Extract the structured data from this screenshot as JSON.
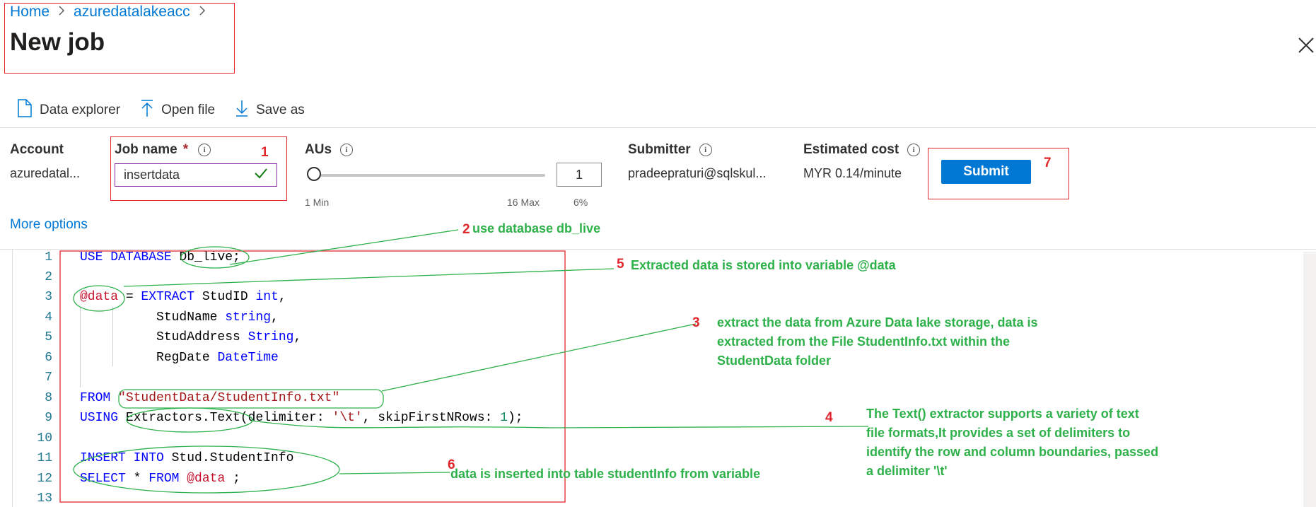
{
  "breadcrumb": {
    "home": "Home",
    "account": "azuredatalakeacc",
    "sep": ">"
  },
  "page_title": "New job",
  "toolbar": {
    "data_explorer": "Data explorer",
    "open_file": "Open file",
    "save_as": "Save as"
  },
  "fields": {
    "account_label": "Account",
    "account_value": "azuredatal...",
    "job_name_label": "Job name",
    "job_name_required": "*",
    "job_name_value": "insertdata",
    "aus_label": "AUs",
    "aus_value": "1",
    "aus_min": "1 Min",
    "aus_max": "16 Max",
    "aus_percent": "6%",
    "submitter_label": "Submitter",
    "submitter_value": "pradeepraturi@sqlskul...",
    "cost_label": "Estimated cost",
    "cost_value": "MYR 0.14/minute",
    "info_glyph": "i"
  },
  "submit_label": "Submit",
  "more_options": "More options",
  "code": {
    "line_numbers": [
      "1",
      "2",
      "3",
      "4",
      "5",
      "6",
      "7",
      "8",
      "9",
      "10",
      "11",
      "12",
      "13"
    ],
    "lines": [
      [
        {
          "t": "USE DATABASE ",
          "c": "kw"
        },
        {
          "t": "Db_live;",
          "c": ""
        }
      ],
      [],
      [
        {
          "t": "@data",
          "c": "var"
        },
        {
          "t": " = ",
          "c": ""
        },
        {
          "t": "EXTRACT",
          "c": "kw"
        },
        {
          "t": " StudID ",
          "c": ""
        },
        {
          "t": "int",
          "c": "kw"
        },
        {
          "t": ",",
          "c": ""
        }
      ],
      [
        {
          "t": "          StudName ",
          "c": ""
        },
        {
          "t": "string",
          "c": "kw"
        },
        {
          "t": ",",
          "c": ""
        }
      ],
      [
        {
          "t": "          StudAddress ",
          "c": ""
        },
        {
          "t": "String",
          "c": "kw"
        },
        {
          "t": ",",
          "c": ""
        }
      ],
      [
        {
          "t": "          RegDate ",
          "c": ""
        },
        {
          "t": "DateTime",
          "c": "kw"
        }
      ],
      [],
      [
        {
          "t": "FROM ",
          "c": "kw"
        },
        {
          "t": "\"StudentData/StudentInfo.txt\"",
          "c": "str"
        }
      ],
      [
        {
          "t": "USING ",
          "c": "kw"
        },
        {
          "t": "Extractors.Text(delimiter: ",
          "c": ""
        },
        {
          "t": "'\\t'",
          "c": "str"
        },
        {
          "t": ", skipFirstNRows: ",
          "c": ""
        },
        {
          "t": "1",
          "c": "num"
        },
        {
          "t": ");",
          "c": ""
        }
      ],
      [],
      [
        {
          "t": "INSERT INTO",
          "c": "kw"
        },
        {
          "t": " Stud.StudentInfo",
          "c": ""
        }
      ],
      [
        {
          "t": "SELECT",
          "c": "kw"
        },
        {
          "t": " * ",
          "c": ""
        },
        {
          "t": "FROM",
          "c": "kw"
        },
        {
          "t": " ",
          "c": ""
        },
        {
          "t": "@data",
          "c": "var"
        },
        {
          "t": " ;",
          "c": ""
        }
      ],
      []
    ]
  },
  "annotations": {
    "n1": "1",
    "n2": "2",
    "n3": "3",
    "n4": "4",
    "n5": "5",
    "n6": "6",
    "n7": "7",
    "a2": "use database db_live",
    "a5": "Extracted data is stored into variable @data",
    "a3": [
      "extract the data from Azure Data lake storage,  data is",
      "extracted from the File StudentInfo.txt within the",
      "StudentData folder"
    ],
    "a4": [
      "The Text() extractor supports a variety of text",
      "file formats,It provides a set of delimiters to",
      "identify the row and column boundaries, passed",
      "a delimiter '\\t'"
    ],
    "a6": "data is inserted into table studentInfo from variable"
  },
  "colors": {
    "accent": "#0078d4",
    "annotation_red": "#e0262b",
    "annotation_green": "#2eb14a"
  }
}
